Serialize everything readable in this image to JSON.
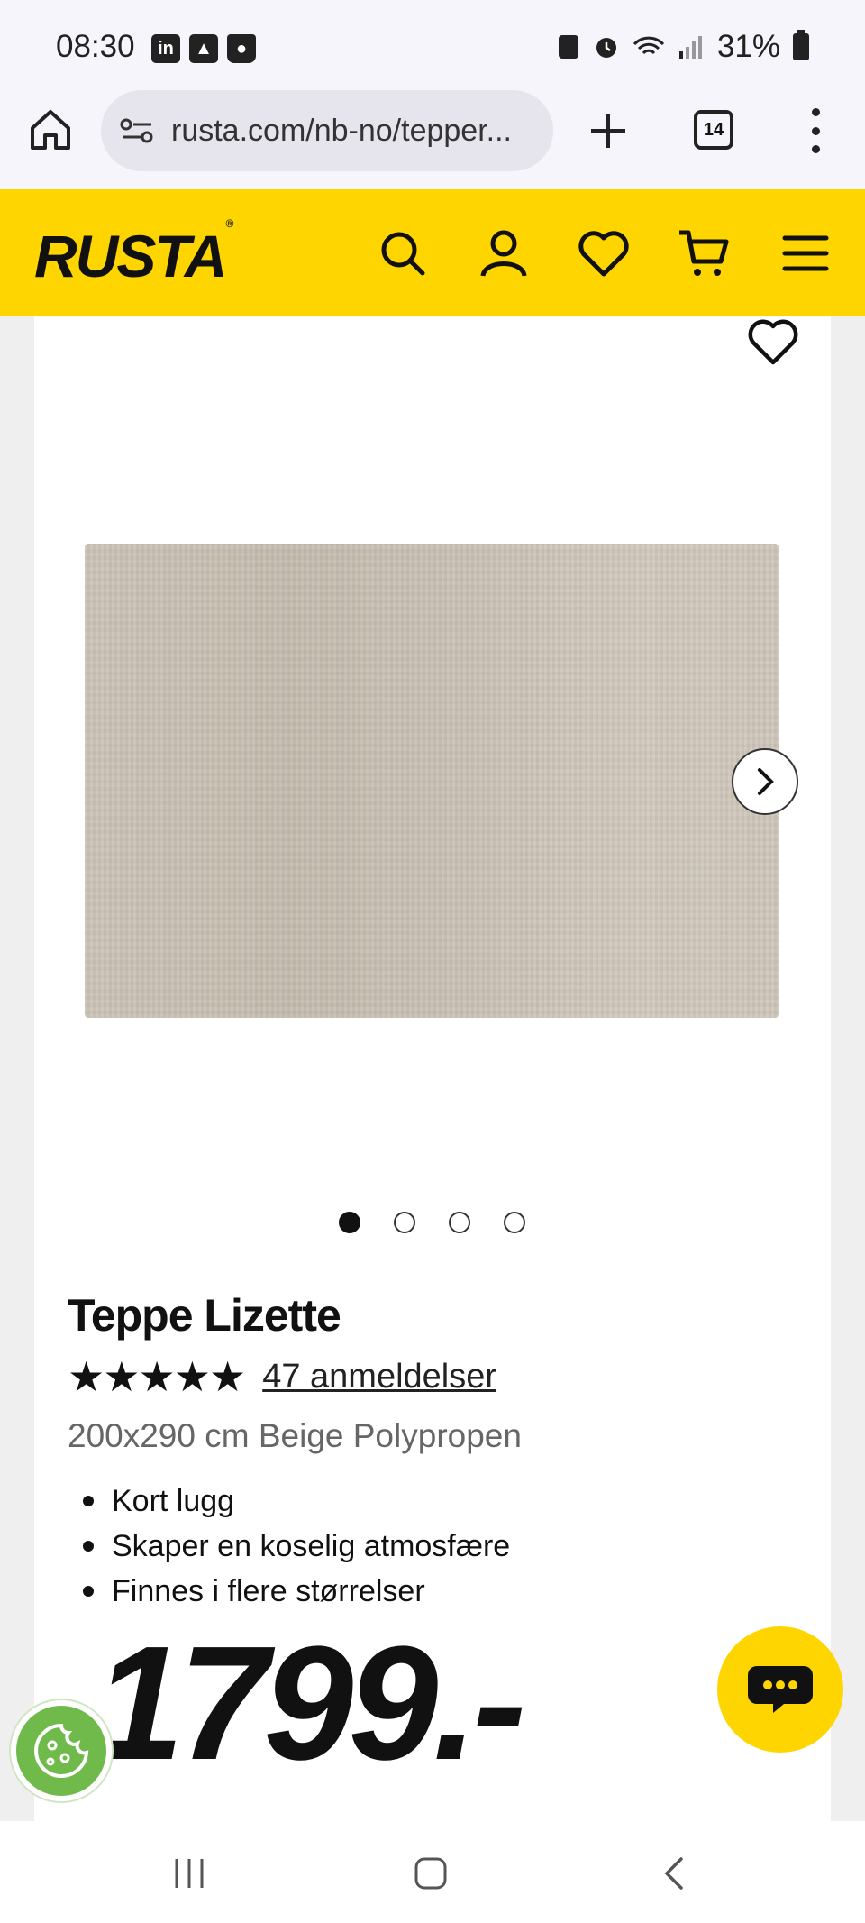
{
  "status_bar": {
    "time": "08:30",
    "left_icons": [
      "linkedin-icon",
      "gallery-icon",
      "shopping-bag-icon"
    ],
    "battery": "31%"
  },
  "browser": {
    "url": "rusta.com/nb-no/tepper...",
    "tab_count": "14"
  },
  "site": {
    "logo": "RUSTA",
    "header_icons": [
      "search-icon",
      "account-icon",
      "wishlist-icon",
      "cart-icon",
      "menu-icon"
    ],
    "brand_color": "#ffd500"
  },
  "product": {
    "title": "Teppe Lizette",
    "stars": "★★★★★",
    "rating": 5,
    "reviews": "47 anmeldelser",
    "subtitle": "200x290 cm Beige Polypropen",
    "features": [
      "Kort lugg",
      "Skaper en koselig atmosfære",
      "Finnes i flere størrelser"
    ],
    "price": "1799.-",
    "image_count": 4,
    "active_image": 1
  }
}
